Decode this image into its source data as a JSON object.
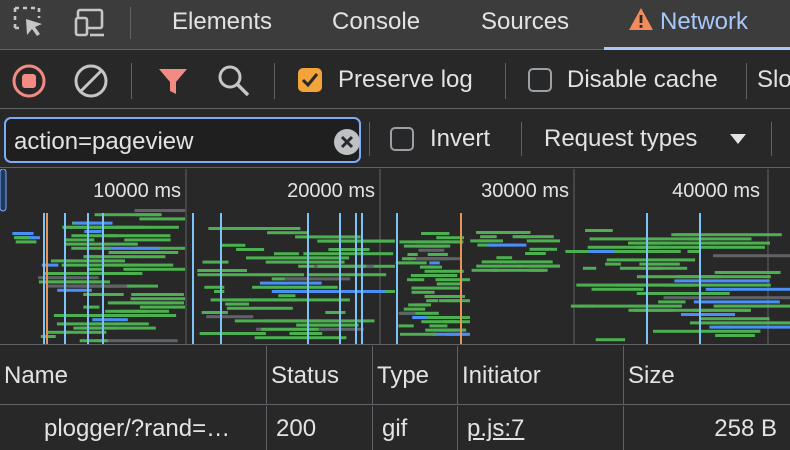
{
  "tabs": [
    {
      "label": "Elements"
    },
    {
      "label": "Console"
    },
    {
      "label": "Sources"
    },
    {
      "label": "Network",
      "active": true,
      "icon": "warning-icon"
    }
  ],
  "toolbar": {
    "preserve_log_label": "Preserve log",
    "preserve_log_checked": true,
    "disable_cache_label": "Disable cache",
    "disable_cache_checked": false,
    "throttling_label": "Slo"
  },
  "filter": {
    "value": "action=pageview",
    "invert_label": "Invert",
    "invert_checked": false,
    "request_types_label": "Request types"
  },
  "overview": {
    "ticks": [
      "10000 ms",
      "20000 ms",
      "30000 ms",
      "40000 ms"
    ]
  },
  "table": {
    "columns": [
      "Name",
      "Status",
      "Type",
      "Initiator",
      "Size"
    ],
    "rows": [
      {
        "name": "plogger/?rand=…",
        "status": "200",
        "type": "gif",
        "initiator": "p.js:7",
        "size": "258 B"
      }
    ]
  },
  "colors": {
    "accent": "#a8c7fa",
    "record": "#f28b82",
    "filter": "#f28b82",
    "checkbox": "#f2a33a",
    "bar_green": "#4caf50",
    "bar_blue": "#4a8ff8",
    "line_cyan": "#7cc4f8",
    "line_orange": "#e8935a"
  }
}
